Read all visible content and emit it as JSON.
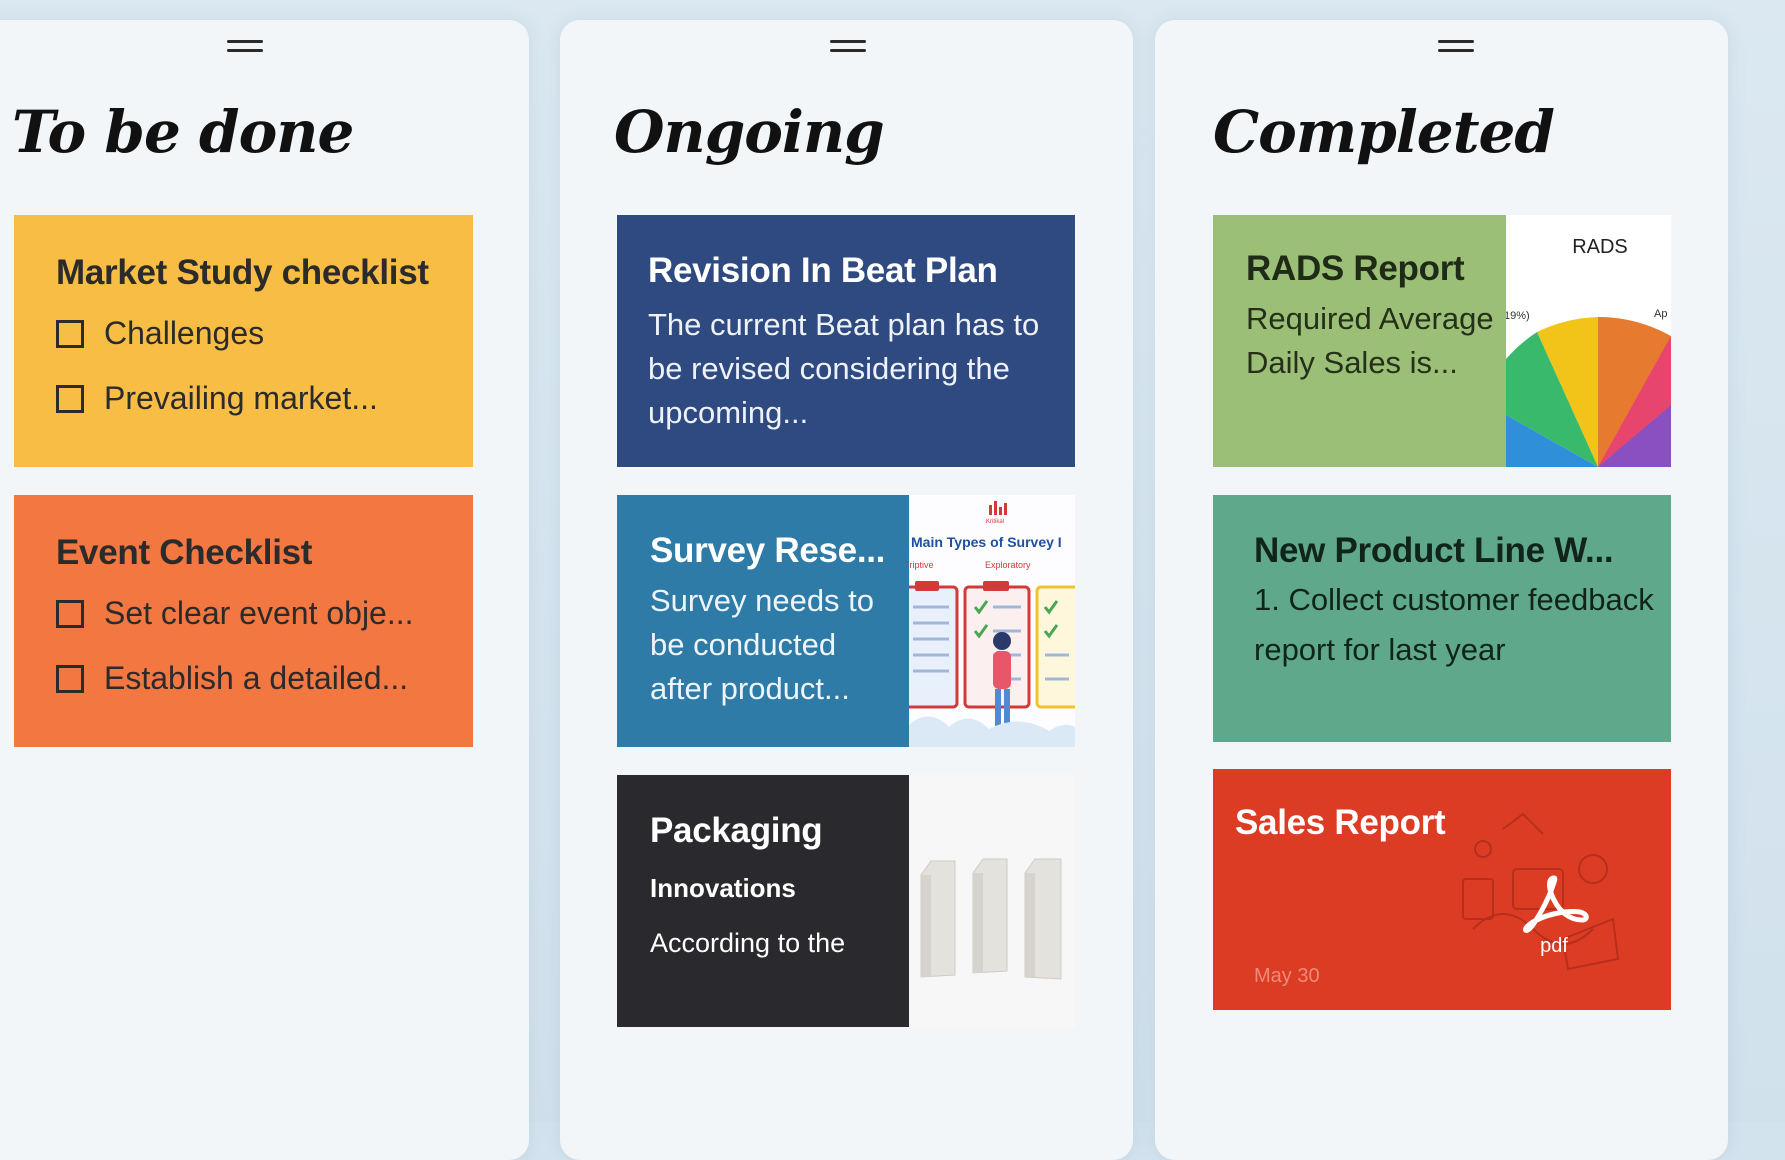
{
  "columns": [
    {
      "title": "To be done",
      "cards": [
        {
          "title": "Market Study checklist",
          "items": [
            "Challenges",
            "Prevailing market..."
          ],
          "color": "#f7bd45"
        },
        {
          "title": "Event Checklist",
          "items": [
            "Set clear event obje...",
            "Establish a detailed..."
          ],
          "color": "#f27740"
        }
      ]
    },
    {
      "title": "Ongoing",
      "cards": [
        {
          "title": "Revision In Beat Plan",
          "body": "The current Beat plan has to be revised considering the upcoming...",
          "color": "#2f4a80"
        },
        {
          "title": "Survey Rese...",
          "body": "Survey needs to be conducted after product...",
          "color": "#2e7ba7",
          "thumb": {
            "logo": "Kritikal",
            "heading": "Main Types of Survey I",
            "labels": [
              "criptive",
              "Exploratory"
            ]
          }
        },
        {
          "title": "Packaging",
          "subtitle": "Innovations",
          "body": "According to the",
          "color": "#2a2a2e"
        }
      ]
    },
    {
      "title": "Completed",
      "cards": [
        {
          "title": "RADS Report",
          "body": "Required Average Daily Sales is...",
          "color": "#9bbf76",
          "thumb": {
            "heading": "RADS",
            "left_label": "19%)",
            "right_label": "Ap"
          }
        },
        {
          "title": "New Product Line W...",
          "body": "1. Collect customer feedback report for last year",
          "color": "#5fa88b"
        },
        {
          "title": "Sales Report",
          "file_type": "pdf",
          "date": "May 30",
          "color": "#dc3c24"
        }
      ]
    }
  ]
}
